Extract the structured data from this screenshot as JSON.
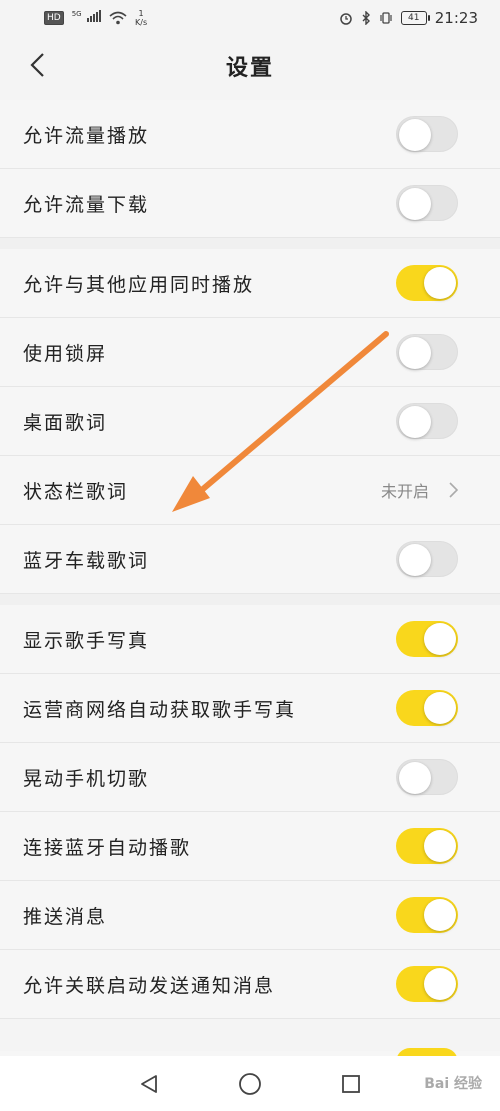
{
  "statusbar": {
    "hd": "HD",
    "network": "5G",
    "speed_value": "1",
    "speed_unit": "K/s",
    "battery": "41",
    "time": "21:23"
  },
  "header": {
    "title": "设置"
  },
  "settings": [
    {
      "label": "允许流量播放",
      "state": "off"
    },
    {
      "label": "允许流量下载",
      "state": "off"
    },
    {
      "label": "允许与其他应用同时播放",
      "state": "on"
    },
    {
      "label": "使用锁屏",
      "state": "off"
    },
    {
      "label": "桌面歌词",
      "state": "off"
    },
    {
      "label": "状态栏歌词",
      "value": "未开启"
    },
    {
      "label": "蓝牙车载歌词",
      "state": "off"
    },
    {
      "label": "显示歌手写真",
      "state": "on"
    },
    {
      "label": "运营商网络自动获取歌手写真",
      "state": "on"
    },
    {
      "label": "晃动手机切歌",
      "state": "off"
    },
    {
      "label": "连接蓝牙自动播歌",
      "state": "on"
    },
    {
      "label": "推送消息",
      "state": "on"
    },
    {
      "label": "允许关联启动发送通知消息",
      "state": "on"
    }
  ],
  "watermark": "Bai 经验",
  "colors": {
    "toggle_on": "#f9d71c",
    "toggle_off": "#e4e4e4",
    "arrow": "#f0883a"
  }
}
